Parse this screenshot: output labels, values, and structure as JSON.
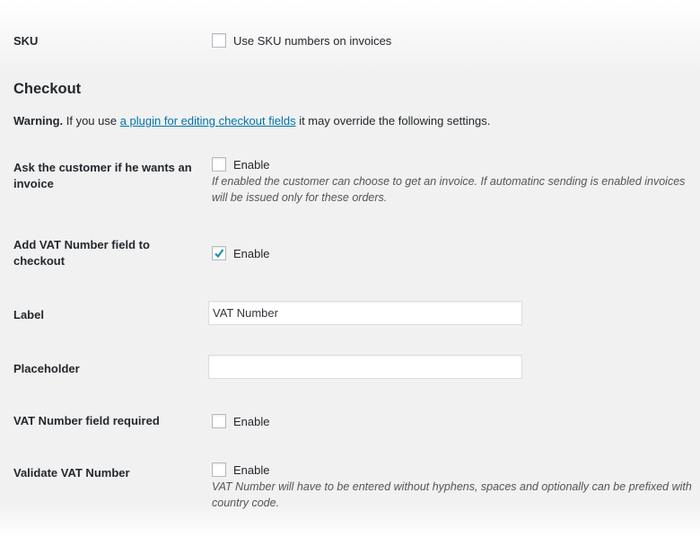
{
  "sku": {
    "label": "SKU",
    "checkbox_label": "Use SKU numbers on invoices",
    "checked": false
  },
  "checkout": {
    "heading": "Checkout",
    "warning": {
      "strong": "Warning.",
      "before": " If you use ",
      "link": "a plugin for editing checkout fields",
      "after": " it may override the following settings."
    },
    "ask_invoice": {
      "label": "Ask the customer if he wants an invoice",
      "checkbox_label": "Enable",
      "checked": false,
      "description": "If enabled the customer can choose to get an invoice. If automatinc sending is enabled invoices will be issued only for these orders."
    },
    "add_vat": {
      "label": "Add VAT Number field to checkout",
      "checkbox_label": "Enable",
      "checked": true
    },
    "field_label": {
      "label": "Label",
      "value": "VAT Number"
    },
    "placeholder": {
      "label": "Placeholder",
      "value": ""
    },
    "vat_required": {
      "label": "VAT Number field required",
      "checkbox_label": "Enable",
      "checked": false
    },
    "validate_vat": {
      "label": "Validate VAT Number",
      "checkbox_label": "Enable",
      "checked": false,
      "description": "VAT Number will have to be entered without hyphens, spaces and optionally can be prefixed with country code."
    }
  },
  "colors": {
    "accent": "#0073aa",
    "check": "#1e8cbe",
    "background": "#f1f1f1"
  }
}
